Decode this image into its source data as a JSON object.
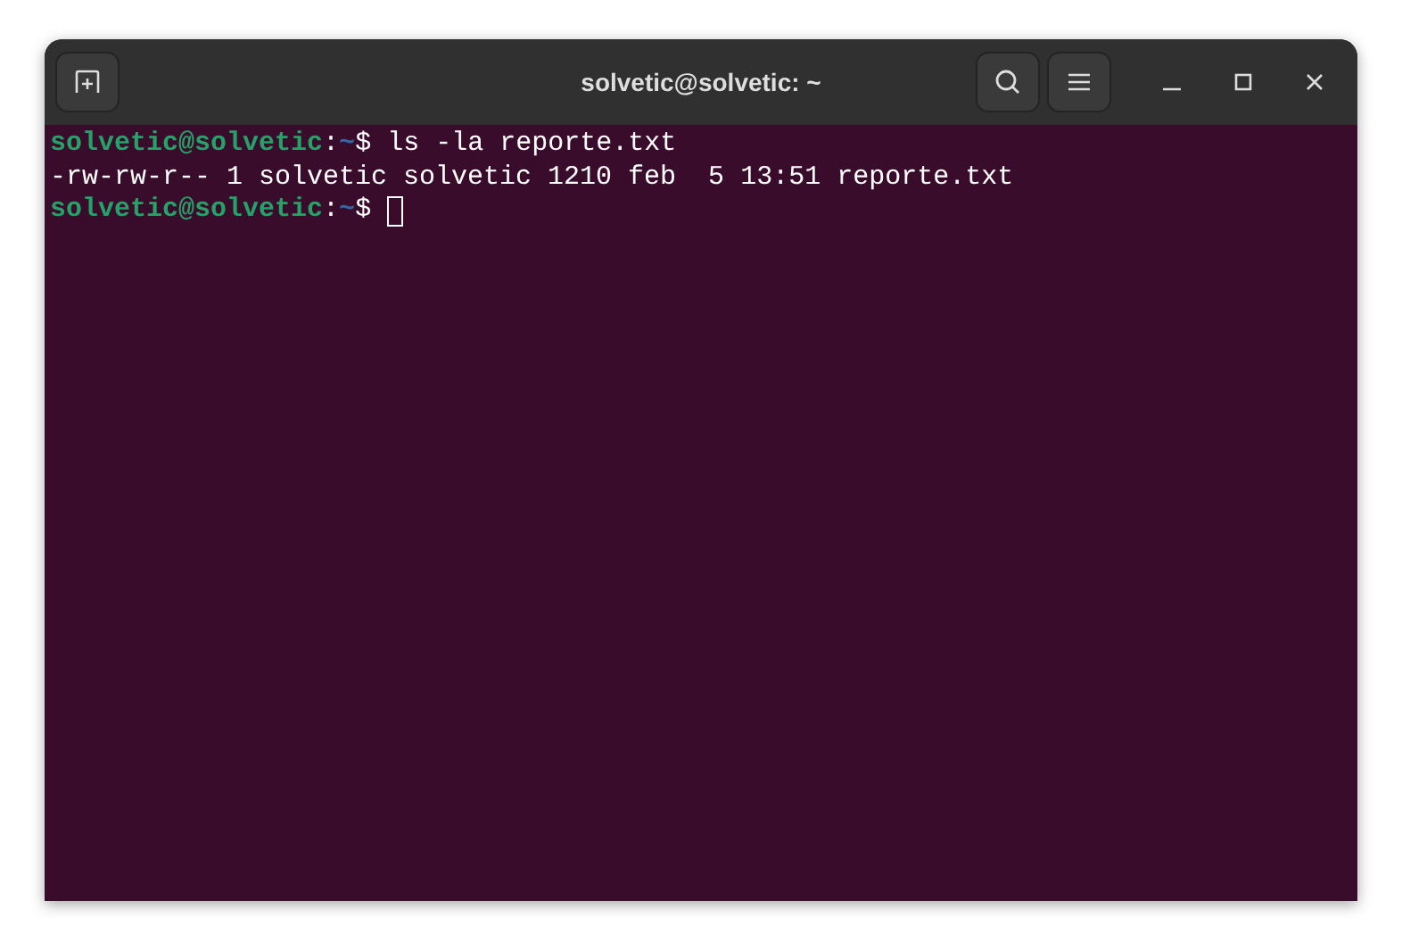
{
  "window": {
    "title": "solvetic@solvetic: ~"
  },
  "terminal": {
    "lines": [
      {
        "kind": "prompt",
        "user_host": "solvetic@solvetic",
        "separator": ":",
        "path": "~",
        "symbol": "$",
        "command": "ls -la reporte.txt",
        "cursor": false
      },
      {
        "kind": "output",
        "text": "-rw-rw-r-- 1 solvetic solvetic 1210 feb  5 13:51 reporte.txt"
      },
      {
        "kind": "prompt",
        "user_host": "solvetic@solvetic",
        "separator": ":",
        "path": "~",
        "symbol": "$",
        "cursor": true
      }
    ]
  }
}
